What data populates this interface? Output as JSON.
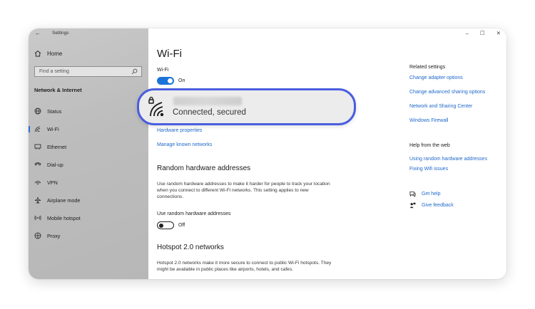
{
  "window": {
    "title": "Settings",
    "back_glyph": "←"
  },
  "window_controls": {
    "minimize": "–",
    "maximize": "☐",
    "close": "✕"
  },
  "sidebar": {
    "home": "Home",
    "search_placeholder": "Find a setting",
    "section_title": "Network & Internet",
    "items": [
      {
        "label": "Status",
        "icon": "globe-icon",
        "active": false
      },
      {
        "label": "Wi-Fi",
        "icon": "wifi-icon",
        "active": true
      },
      {
        "label": "Ethernet",
        "icon": "ethernet-icon",
        "active": false
      },
      {
        "label": "Dial-up",
        "icon": "dialup-icon",
        "active": false
      },
      {
        "label": "VPN",
        "icon": "vpn-icon",
        "active": false
      },
      {
        "label": "Airplane mode",
        "icon": "airplane-icon",
        "active": false
      },
      {
        "label": "Mobile hotspot",
        "icon": "hotspot-icon",
        "active": false
      },
      {
        "label": "Proxy",
        "icon": "proxy-icon",
        "active": false
      }
    ]
  },
  "main": {
    "title": "Wi-Fi",
    "wifi_label": "Wi-Fi",
    "wifi_toggle_state": "On",
    "network_status": "Connected, secured",
    "hardware_properties": "Hardware properties",
    "manage_known_networks": "Manage known networks",
    "random_hw": {
      "heading": "Random hardware addresses",
      "description": "Use random hardware addresses to make it harder for people to track your location when you connect to different Wi-Fi networks. This setting applies to new connections.",
      "toggle_label": "Use random hardware addresses",
      "toggle_state": "Off"
    },
    "hotspot": {
      "heading": "Hotspot 2.0 networks",
      "description": "Hotspot 2.0 networks make it more secure to connect to public Wi-Fi hotspots. They might be available in public places like airports, hotels, and cafes."
    }
  },
  "related": {
    "heading": "Related settings",
    "links": [
      "Change adapter options",
      "Change advanced sharing options",
      "Network and Sharing Center",
      "Windows Firewall"
    ]
  },
  "help": {
    "heading": "Help from the web",
    "links": [
      "Using random hardware addresses",
      "Fixing Wifi issues"
    ],
    "get_help": "Get help",
    "give_feedback": "Give feedback"
  },
  "colors": {
    "accent": "#1a73d9",
    "link": "#1f68c9",
    "highlight_border": "#4a5ee0"
  }
}
